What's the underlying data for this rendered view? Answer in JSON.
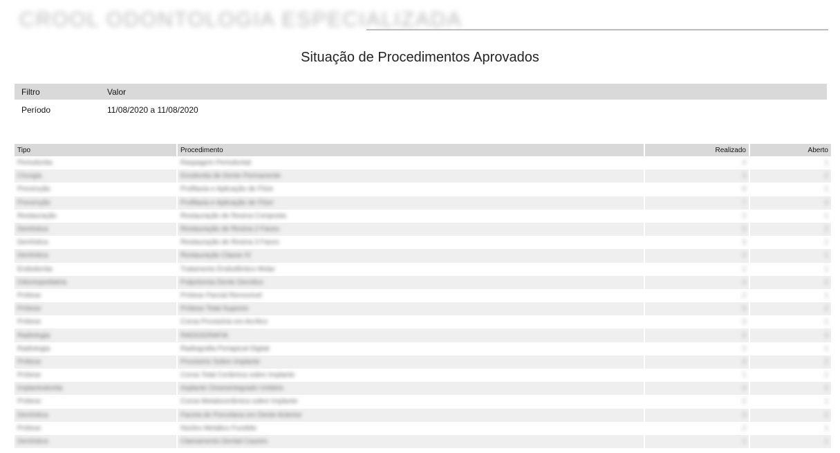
{
  "header": {
    "logo_text": "CROOL ODONTOLOGIA ESPECIALIZADA"
  },
  "report": {
    "title": "Situação de Procedimentos Aprovados"
  },
  "filter_table": {
    "headers": [
      "Filtro",
      "Valor"
    ],
    "rows": [
      {
        "filter": "Período",
        "value": "11/08/2020 a 11/08/2020"
      }
    ]
  },
  "procedures_table": {
    "headers": {
      "tipo": "Tipo",
      "procedimento": "Procedimento",
      "realizado": "Realizado",
      "aberto": "Aberto"
    },
    "rows": [
      {
        "tipo": "Periodontia",
        "procedimento": "Raspagem Periodontal",
        "realizado": "4",
        "aberto": "1"
      },
      {
        "tipo": "Cirurgia",
        "procedimento": "Exodontia de Dente Permanente",
        "realizado": "3",
        "aberto": "2"
      },
      {
        "tipo": "Prevenção",
        "procedimento": "Profilaxia e Aplicação de Flúor",
        "realizado": "6",
        "aberto": "1"
      },
      {
        "tipo": "Prevenção",
        "procedimento": "Profilaxia e Aplicação de Flúor",
        "realizado": "7",
        "aberto": "3"
      },
      {
        "tipo": "Restauração",
        "procedimento": "Restauração de Resina Composta",
        "realizado": "2",
        "aberto": "1"
      },
      {
        "tipo": "Dentística",
        "procedimento": "Restauração de Resina 2 Faces",
        "realizado": "5",
        "aberto": "2"
      },
      {
        "tipo": "Dentística",
        "procedimento": "Restauração de Resina 3 Faces",
        "realizado": "3",
        "aberto": "1"
      },
      {
        "tipo": "Dentística",
        "procedimento": "Restauração Classe IV",
        "realizado": "2",
        "aberto": "1"
      },
      {
        "tipo": "Endodontia",
        "procedimento": "Tratamento Endodôntico Molar",
        "realizado": "1",
        "aberto": "1"
      },
      {
        "tipo": "Odontopediatria",
        "procedimento": "Pulpotomia Dente Decíduo",
        "realizado": "4",
        "aberto": "2"
      },
      {
        "tipo": "Prótese",
        "procedimento": "Prótese Parcial Removível",
        "realizado": "2",
        "aberto": "1"
      },
      {
        "tipo": "Prótese",
        "procedimento": "Prótese Total Superior",
        "realizado": "5",
        "aberto": "2"
      },
      {
        "tipo": "Prótese",
        "procedimento": "Coroa Provisória em Acrílico",
        "realizado": "3",
        "aberto": "1"
      },
      {
        "tipo": "Radiologia",
        "procedimento": "RADIOGRAFIA",
        "realizado": "6",
        "aberto": "3"
      },
      {
        "tipo": "Radiologia",
        "procedimento": "Radiografia Periapical Digital",
        "realizado": "2",
        "aberto": "1"
      },
      {
        "tipo": "Prótese",
        "procedimento": "Provisório Sobre Implante",
        "realizado": "3",
        "aberto": "2"
      },
      {
        "tipo": "Prótese",
        "procedimento": "Coroa Total Cerâmica sobre Implante",
        "realizado": "1",
        "aberto": "1"
      },
      {
        "tipo": "Implantodontia",
        "procedimento": "Implante Osseointegrado Unitário",
        "realizado": "4",
        "aberto": "2"
      },
      {
        "tipo": "Prótese",
        "procedimento": "Coroa Metalocerâmica sobre Implante",
        "realizado": "2",
        "aberto": "1"
      },
      {
        "tipo": "Dentística",
        "procedimento": "Faceta de Porcelana em Dente Anterior",
        "realizado": "3",
        "aberto": "2"
      },
      {
        "tipo": "Prótese",
        "procedimento": "Núcleo Metálico Fundido",
        "realizado": "2",
        "aberto": "1"
      },
      {
        "tipo": "Dentística",
        "procedimento": "Clareamento Dental Caseiro",
        "realizado": "1",
        "aberto": "1"
      }
    ]
  }
}
